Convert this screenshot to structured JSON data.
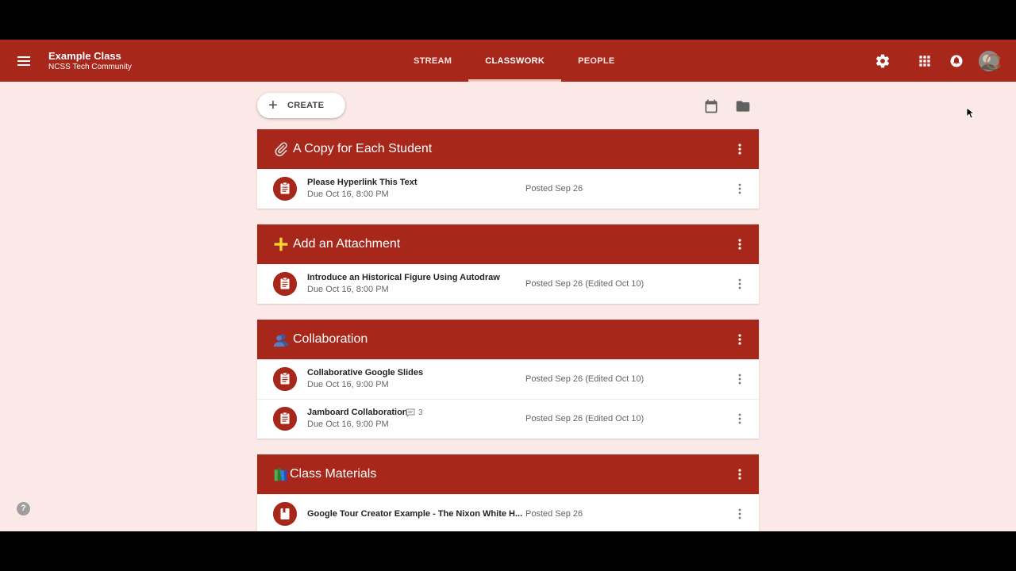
{
  "header": {
    "class_name": "Example Class",
    "class_section": "NCSS Tech Community",
    "tabs": [
      {
        "label": "STREAM",
        "active": false
      },
      {
        "label": "CLASSWORK",
        "active": true
      },
      {
        "label": "PEOPLE",
        "active": false
      }
    ],
    "icons": [
      "menu-icon",
      "settings-icon",
      "apps-icon",
      "notifications-icon",
      "avatar"
    ]
  },
  "toolbar": {
    "create_label": "CREATE",
    "icons": [
      "calendar-icon",
      "folder-icon"
    ]
  },
  "topics": [
    {
      "emoji": "paperclip-icon",
      "title": "A Copy for Each Student",
      "items": [
        {
          "title": "Please Hyperlink This Text",
          "due": "Due Oct 16, 8:00 PM",
          "posted": "Posted Sep 26",
          "type": "assignment"
        }
      ]
    },
    {
      "emoji": "plus-icon",
      "title": "Add an Attachment",
      "items": [
        {
          "title": "Introduce an Historical Figure Using Autodraw",
          "due": "Due Oct 16, 8:00 PM",
          "posted": "Posted Sep 26 (Edited Oct 10)",
          "type": "assignment"
        }
      ]
    },
    {
      "emoji": "people-icon",
      "title": "Collaboration",
      "items": [
        {
          "title": "Collaborative Google Slides",
          "due": "Due Oct 16, 9:00 PM",
          "posted": "Posted Sep 26 (Edited Oct 10)",
          "type": "assignment"
        },
        {
          "title": "Jamboard Collaboration",
          "due": "Due Oct 16, 9:00 PM",
          "posted": "Posted Sep 26 (Edited Oct 10)",
          "type": "assignment",
          "comments": "3"
        }
      ]
    },
    {
      "emoji": "books-icon",
      "title": "Class Materials",
      "items": [
        {
          "title": "Google Tour Creator Example - The Nixon White H...",
          "due": "",
          "posted": "Posted Sep 26",
          "type": "material"
        }
      ]
    }
  ],
  "help_label": "?",
  "colors": {
    "accent": "#a8271b",
    "background": "#fbe9e7"
  }
}
